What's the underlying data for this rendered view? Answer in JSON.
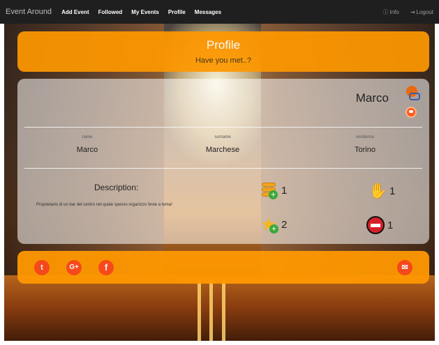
{
  "navbar": {
    "brand": "Event Around",
    "items": [
      "Add Event",
      "Followed",
      "My Events",
      "Profile",
      "Messages"
    ],
    "info_label": "Info",
    "logout_label": "Logout"
  },
  "header": {
    "title": "Profile",
    "subtitle": "Have you met..?"
  },
  "profile": {
    "display_name": "Marco",
    "name_label": "name",
    "name": "Marco",
    "surname_label": "surname",
    "surname": "Marchese",
    "residence_label": "residence",
    "residence": "Torino",
    "description_title": "Description:",
    "description": "Proprietario di un bar del centro nel quale spesso organizzo feste a tema!"
  },
  "stats": {
    "events_added": "1",
    "likes": "1",
    "favorites": "2",
    "dislikes": "1"
  },
  "icons": {
    "brand_accent": "#ff9800",
    "social": [
      "twitter-icon",
      "google-plus-icon",
      "facebook-icon"
    ],
    "mail": "mail-icon"
  }
}
